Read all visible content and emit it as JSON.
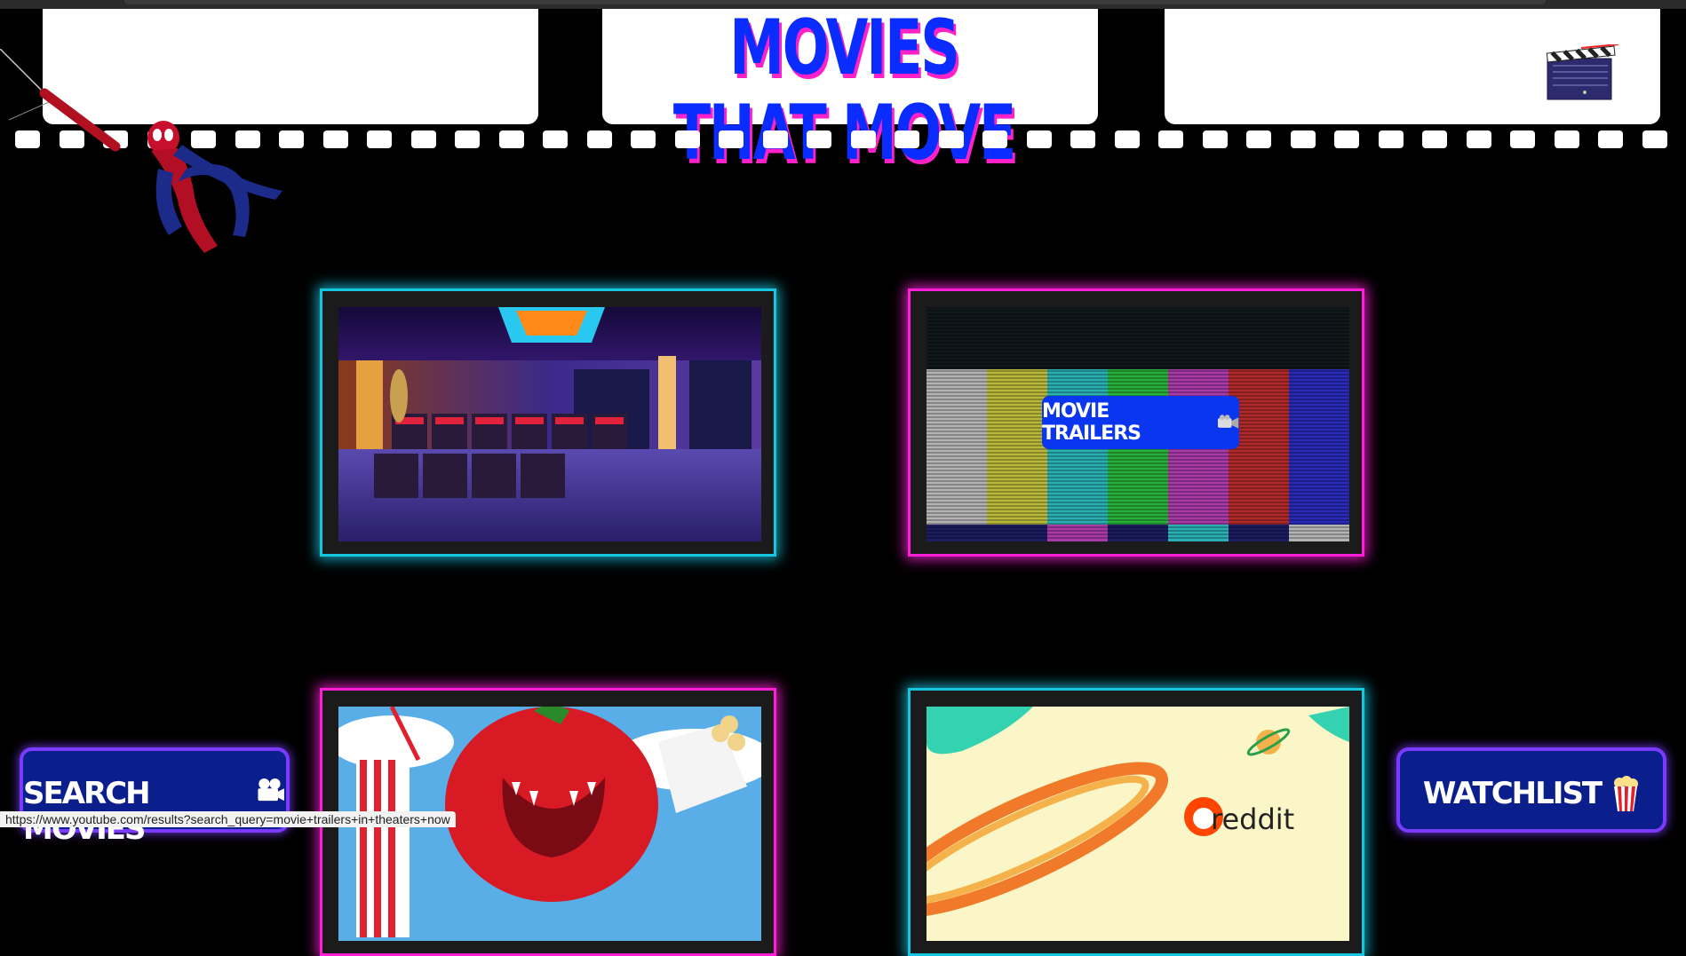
{
  "site": {
    "title": "MOVIES THAT MOVE"
  },
  "cards": [
    {
      "name": "home-theater",
      "icon": "home-theater-image"
    },
    {
      "name": "movie-trailers",
      "button_label": "MOVIE TRAILERS",
      "icon": "video-camera-icon"
    },
    {
      "name": "rotten-tomatoes",
      "icon": "tomato-monster-image"
    },
    {
      "name": "reddit",
      "text": "reddit",
      "icon": "reddit-planet-image"
    }
  ],
  "nav": {
    "search_label": "SEARCH MOVIES",
    "search_icon": "film-camera-icon",
    "watchlist_label": "WATCHLIST",
    "watchlist_icon": "popcorn-icon"
  },
  "status_bar": {
    "url": "https://www.youtube.com/results?search_query=movie+trailers+in+theaters+now"
  },
  "colors": {
    "title_blue": "#0a2cff",
    "title_shadow_pink": "#ff21c8",
    "cyan_glow": "#15c6de",
    "pink_glow": "#ff1ed8",
    "button_blue": "#0a36f0",
    "nav_blue": "#0b1f8c",
    "nav_border_purple": "#7b3bff"
  }
}
